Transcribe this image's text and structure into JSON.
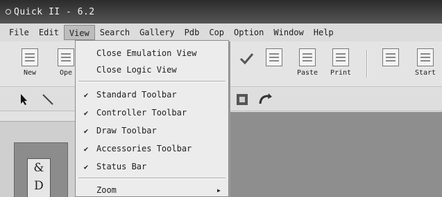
{
  "window": {
    "title": "Quick II - 6.2"
  },
  "menubar": {
    "items": [
      "File",
      "Edit",
      "View",
      "Search",
      "Gallery",
      "Pdb",
      "Cop",
      "Option",
      "Window",
      "Help"
    ],
    "active_index": 2
  },
  "toolbar": {
    "new_label": "New",
    "open_label": "Ope",
    "paste_label": "Paste",
    "print_label": "Print",
    "start_label": "Start"
  },
  "view_menu": {
    "items": [
      {
        "label": "Close Emulation View",
        "checked": false
      },
      {
        "label": "Close Logic View",
        "checked": false
      },
      {
        "label": "Standard Toolbar",
        "checked": true
      },
      {
        "label": "Controller Toolbar",
        "checked": true
      },
      {
        "label": "Draw Toolbar",
        "checked": true
      },
      {
        "label": "Accessories Toolbar",
        "checked": true
      },
      {
        "label": "Status Bar",
        "checked": true
      },
      {
        "label": "Zoom",
        "checked": false,
        "submenu": true
      }
    ],
    "check_glyph": "✔",
    "submenu_glyph": "▶"
  },
  "left_panel": {
    "tile_text": "& D"
  }
}
